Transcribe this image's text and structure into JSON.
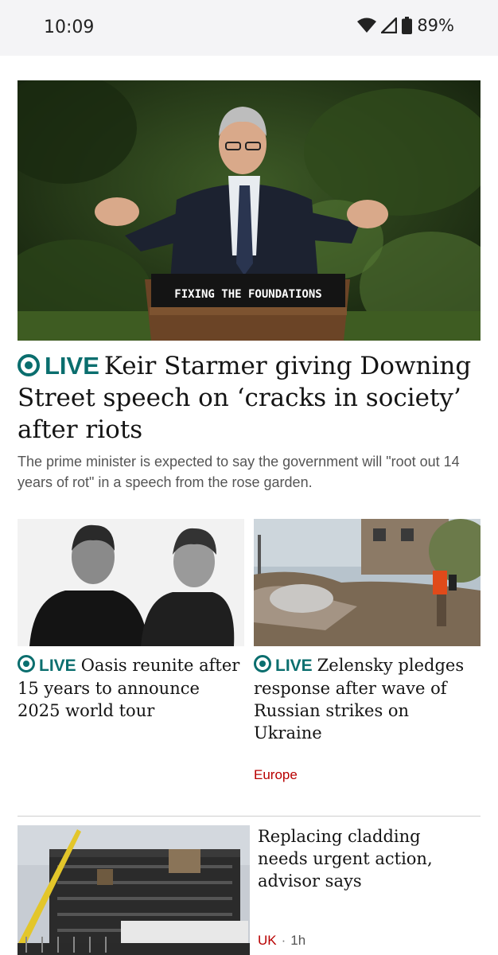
{
  "status_bar": {
    "time": "10:09",
    "battery": "89%"
  },
  "hero": {
    "podium_sign": "FIXING THE FOUNDATIONS",
    "live_label": "LIVE",
    "headline": "Keir Starmer giving Downing Street speech on ‘cracks in society’ after riots",
    "summary": "The prime minister is expected to say the government will \"root out 14 years of rot\" in a speech from the rose garden."
  },
  "cards": [
    {
      "live_label": "LIVE",
      "title": "Oasis reunite after 15 years to announce 2025 world tour"
    },
    {
      "live_label": "LIVE",
      "title": "Zelensky pledges response after wave of Russian strikes on Ukraine",
      "tag": "Europe"
    }
  ],
  "story": {
    "title": "Replacing cladding needs urgent action, advisor says",
    "tag": "UK",
    "separator": "·",
    "time": "1h"
  },
  "colors": {
    "live": "#0a6e6e",
    "tag": "#b80000",
    "statusbar_bg": "#f4f4f6"
  }
}
